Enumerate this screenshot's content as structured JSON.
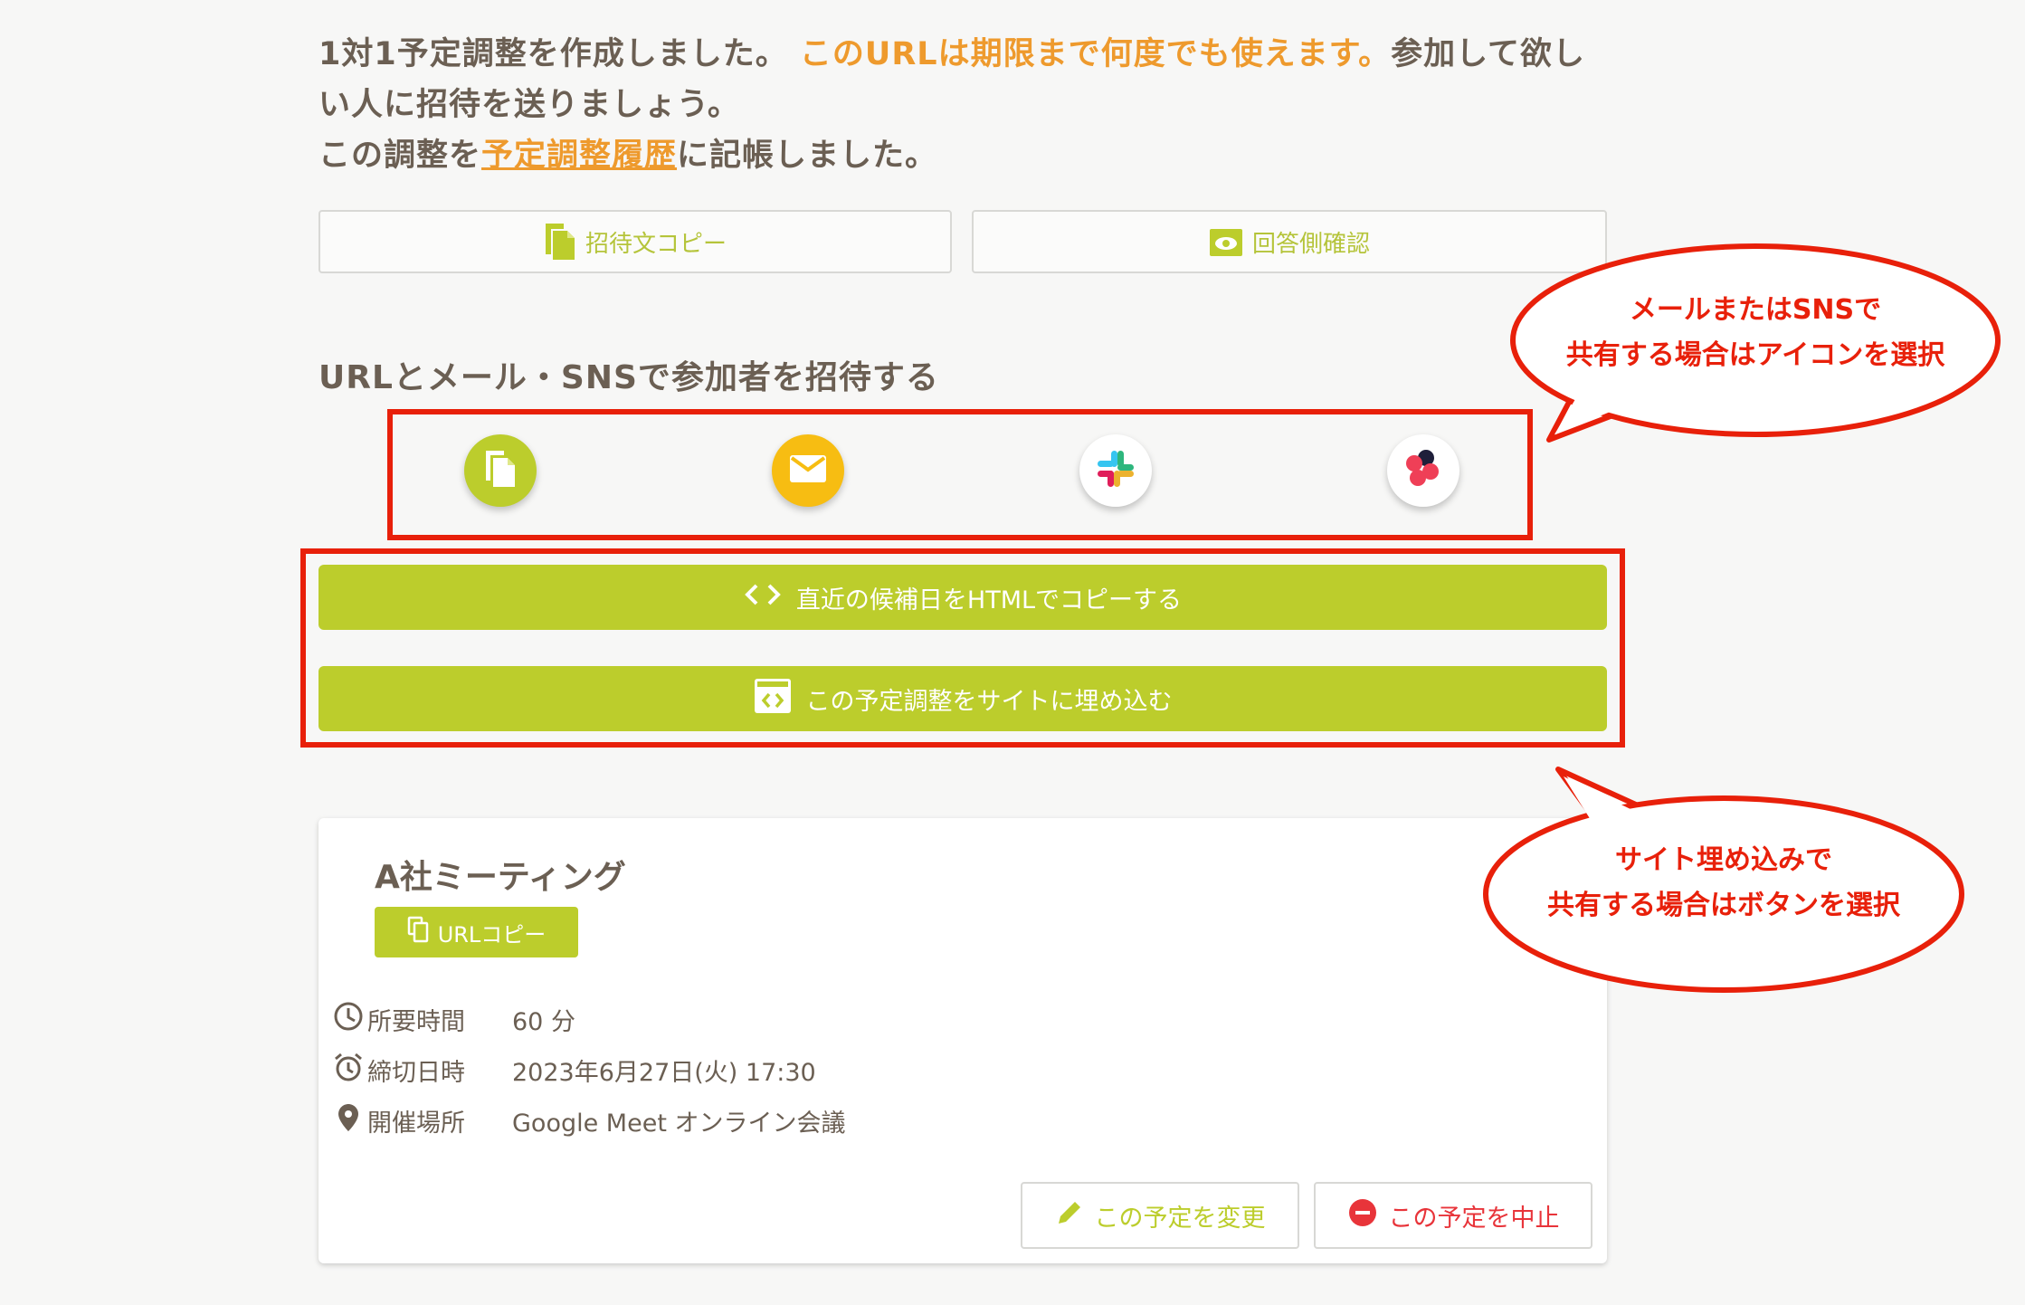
{
  "intro": {
    "line1_part1": "1対1予定調整を作成しました。",
    "line1_highlight": "このURLは期限まで何度でも使えます。",
    "line1_part2": "参加して欲しい人に招待を送りましょう。",
    "line2_prefix": "この調整を",
    "line2_link": "予定調整履歴",
    "line2_suffix": "に記帳しました。"
  },
  "top_buttons": {
    "copy_invite": "招待文コピー",
    "respondent_view": "回答側確認"
  },
  "share_section": {
    "title": "URLとメール・SNSで参加者を招待する",
    "icons": [
      "copy-icon",
      "mail-icon",
      "slack-icon",
      "asana-icon"
    ]
  },
  "embed_buttons": {
    "copy_html": "直近の候補日をHTMLでコピーする",
    "embed_site": "この予定調整をサイトに埋め込む"
  },
  "card": {
    "title": "A社ミーティング",
    "url_copy": "URLコピー",
    "rows": [
      {
        "label": "所要時間",
        "value": "60 分"
      },
      {
        "label": "締切日時",
        "value": "2023年6月27日(火) 17:30"
      },
      {
        "label": "開催場所",
        "value": "Google Meet オンライン会議"
      }
    ],
    "edit_button": "この予定を変更",
    "cancel_button": "この予定を中止"
  },
  "annotations": {
    "bubble1_line1": "メールまたはSNSで",
    "bubble1_line2": "共有する場合はアイコンを選択",
    "bubble2_line1": "サイト埋め込みで",
    "bubble2_line2": "共有する場合はボタンを選択"
  },
  "colors": {
    "accent_green": "#bccd2c",
    "orange": "#ee9a2d",
    "annotation_red": "#e8200a",
    "mail_yellow": "#f7bd12",
    "cancel_red": "#e8343a"
  }
}
